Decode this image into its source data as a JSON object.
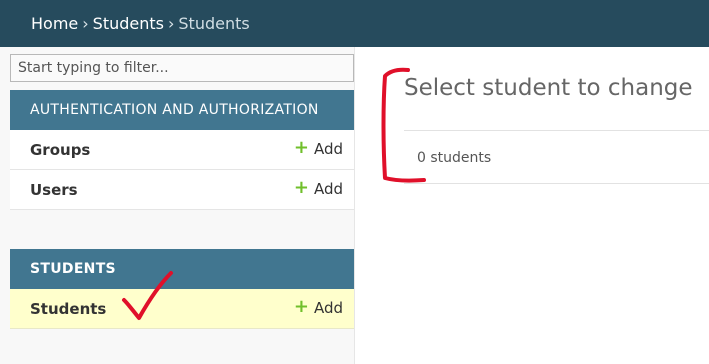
{
  "breadcrumb": {
    "home": "Home",
    "separator": "›",
    "app": "Students",
    "current": "Students"
  },
  "sidebar": {
    "filter_placeholder": "Start typing to filter...",
    "modules": [
      {
        "header": "AUTHENTICATION AND AUTHORIZATION",
        "models": [
          {
            "name": "Groups",
            "add_label": "Add"
          },
          {
            "name": "Users",
            "add_label": "Add"
          }
        ]
      },
      {
        "header": "STUDENTS",
        "models": [
          {
            "name": "Students",
            "add_label": "Add",
            "selected": true
          }
        ]
      }
    ]
  },
  "content": {
    "title": "Select student to change",
    "result_count": "0 students"
  },
  "icons": {
    "add": "plus-icon"
  },
  "colors": {
    "header_bar": "#264b5d",
    "module_header": "#417690",
    "selected_row": "#ffffcc",
    "add_icon": "#70bf2b",
    "annotation": "#e0102a"
  }
}
